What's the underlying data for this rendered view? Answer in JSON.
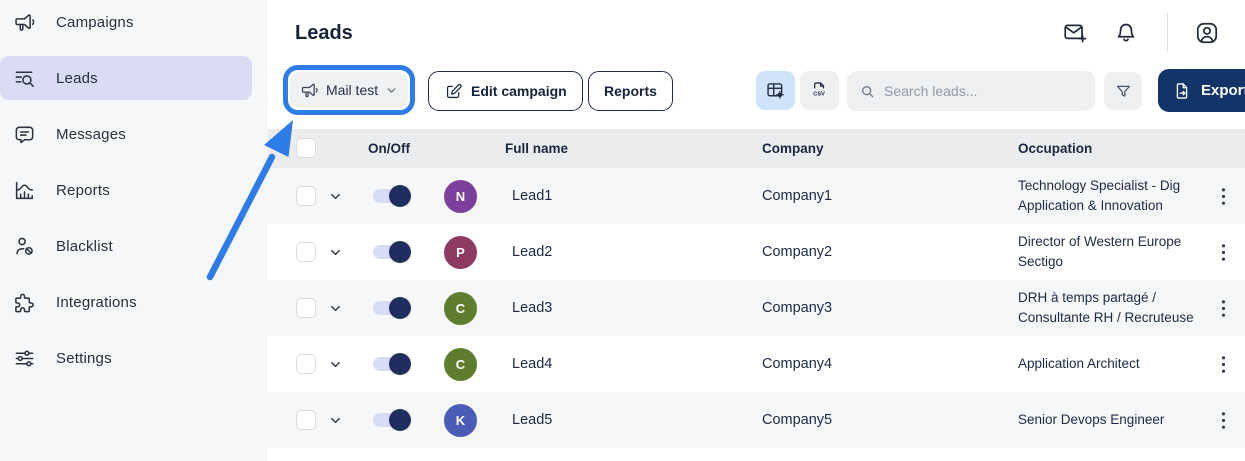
{
  "colors": {
    "annotation_blue": "#2e7ce8",
    "export_navy": "#123469",
    "sidebar_active_bg": "#dadcf3",
    "view_toggle_active_bg": "#d0e3f8",
    "toggle_track": "#d6dcf6",
    "toggle_knob": "#1f2e5f",
    "table_header_bg": "#ebecee",
    "row_stripe_bg": "#f6f7f9"
  },
  "sidebar": {
    "items": [
      {
        "label": "Campaigns",
        "icon": "megaphone-icon",
        "active": false
      },
      {
        "label": "Leads",
        "icon": "leads-search-icon",
        "active": true
      },
      {
        "label": "Messages",
        "icon": "message-icon",
        "active": false
      },
      {
        "label": "Reports",
        "icon": "chart-icon",
        "active": false
      },
      {
        "label": "Blacklist",
        "icon": "user-block-icon",
        "active": false
      },
      {
        "label": "Integrations",
        "icon": "puzzle-icon",
        "active": false
      },
      {
        "label": "Settings",
        "icon": "sliders-icon",
        "active": false
      }
    ]
  },
  "header": {
    "title": "Leads",
    "icons": [
      "mail-plus-icon",
      "bell-icon",
      "account-icon"
    ]
  },
  "toolbar": {
    "campaign_dropdown_label": "Mail test",
    "edit_campaign_label": "Edit campaign",
    "reports_label": "Reports",
    "csv_text": "CSV",
    "search_placeholder": "Search leads...",
    "export_label": "Export data"
  },
  "table": {
    "columns": [
      "On/Off",
      "Full name",
      "Company",
      "Occupation"
    ],
    "rows": [
      {
        "name": "Lead1",
        "company": "Company1",
        "enabled": true,
        "occupation_lines": [
          "Technology Specialist - Dig",
          "Application & Innovation"
        ],
        "avatar_letter": "N",
        "avatar_color": "#7d3f9c"
      },
      {
        "name": "Lead2",
        "company": "Company2",
        "enabled": true,
        "occupation_lines": [
          "Director of Western Europe",
          "Sectigo"
        ],
        "avatar_letter": "P",
        "avatar_color": "#8e3a62"
      },
      {
        "name": "Lead3",
        "company": "Company3",
        "enabled": true,
        "occupation_lines": [
          "DRH à temps partagé /",
          "Consultante RH / Recruteuse"
        ],
        "avatar_letter": "C",
        "avatar_color": "#5e7e2d"
      },
      {
        "name": "Lead4",
        "company": "Company4",
        "enabled": true,
        "occupation_lines": [
          "Application Architect"
        ],
        "avatar_letter": "C",
        "avatar_color": "#5e7e2d"
      },
      {
        "name": "Lead5",
        "company": "Company5",
        "enabled": true,
        "occupation_lines": [
          "Senior Devops Engineer"
        ],
        "avatar_letter": "K",
        "avatar_color": "#4a5cb5"
      }
    ]
  }
}
